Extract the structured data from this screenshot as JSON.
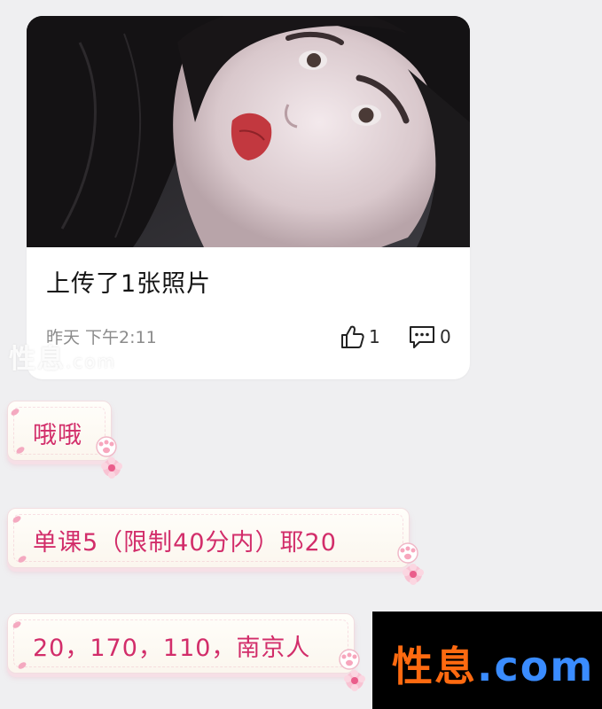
{
  "post": {
    "caption": "上传了1张照片",
    "time": "昨天 下午2:11",
    "likes": "1",
    "comments": "0",
    "photo_icon": "portrait-photo"
  },
  "watermark_ghost": {
    "main": "性息",
    "suffix": ".com"
  },
  "messages": [
    {
      "text": "哦哦"
    },
    {
      "text": "单课5（限制40分内）耶20"
    },
    {
      "text": "20，170，110，南京人"
    }
  ],
  "brand": {
    "main": "性息",
    "suffix": ".com"
  },
  "colors": {
    "background": "#efeff1",
    "bubble_text": "#d22d6a",
    "brand_orange": "#ff6a10",
    "brand_blue": "#3a8cff"
  }
}
